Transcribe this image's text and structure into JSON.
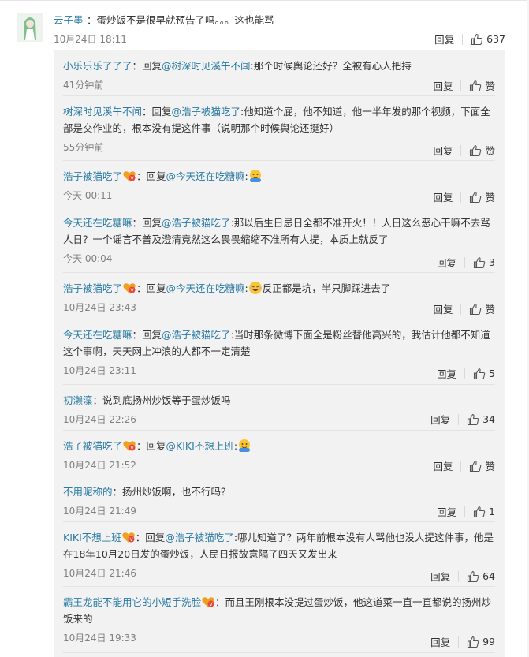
{
  "ui": {
    "reply_label": "回复",
    "zan_label": "赞",
    "reply_prefix": "：回复",
    "colon": "："
  },
  "main_comment": {
    "username": "云子墨-",
    "text": "：蛋炒饭不是很早就预告了吗。。。这也能骂",
    "time": "10月24日 18:11",
    "likes": "637"
  },
  "replies": [
    {
      "user": "小乐乐乐了了了",
      "to": "@树深时见溪午不闻",
      "body": ":那个时候舆论还好？全被有心人把持",
      "time": "41分钟前",
      "likes": "赞"
    },
    {
      "user": "树深时见溪午不闻",
      "to": "@浩子被猫吃了",
      "body": ":他知道个屁，他不知道，他一半年发的那个视频，下面全部是交作业的，根本没有提这件事（说明那个时候舆论还挺好）",
      "time": "55分钟前",
      "likes": "赞"
    },
    {
      "user": "浩子被猫吃了",
      "to": "@今天还在吃糖嘛",
      "body": ":",
      "time": "今天 00:11",
      "likes": "赞",
      "badge": true,
      "emoji": "hug"
    },
    {
      "user": "今天还在吃糖嘛",
      "to": "@浩子被猫吃了",
      "body": ":那以后生日忌日全都不准开火！！人日这么恶心干嘛不去骂人日？一个谣言不普及澄清竟然这么畏畏缩缩不准所有人提，本质上就反了",
      "time": "今天 00:04",
      "likes": "3"
    },
    {
      "user": "浩子被猫吃了",
      "to": "@今天还在吃糖嘛",
      "body": ":",
      "body2": "反正都是坑，半只脚踩进去了",
      "time": "10月24日 23:43",
      "likes": "赞",
      "badge": true,
      "emoji": "laugh"
    },
    {
      "user": "今天还在吃糖嘛",
      "to": "@浩子被猫吃了",
      "body": ":当时那条微博下面全是粉丝替他高兴的，我估计他都不知道这个事啊，天天网上冲浪的人都不一定清楚",
      "time": "10月24日 23:11",
      "likes": "5"
    },
    {
      "user": "初濑澟",
      "plain": "：说到底扬州炒饭等于蛋炒饭吗",
      "time": "10月24日 22:26",
      "likes": "34"
    },
    {
      "user": "浩子被猫吃了",
      "to": "@KIKI不想上班",
      "body": ":",
      "time": "10月24日 21:52",
      "likes": "赞",
      "badge": true,
      "emoji": "hug"
    },
    {
      "user": "不用昵称的",
      "plain": "：扬州炒饭啊，也不行吗？",
      "time": "10月24日 21:49",
      "likes": "1"
    },
    {
      "user": "KIKI不想上班",
      "to": "@浩子被猫吃了",
      "body": ":哪儿知道了？两年前根本没有人骂他也没人提这件事，他是在18年10月20日发的蛋炒饭，人民日报故意隔了四天又发出来",
      "time": "10月24日 21:46",
      "likes": "64",
      "badge": true
    },
    {
      "user": "霸王龙能不能用它的小短手洗脸",
      "plain": "：而且王刚根本没提过蛋炒饭，他这道菜一直一直都说的扬州炒饭来的",
      "time": "10月24日 19:33",
      "likes": "99",
      "badge": true
    }
  ],
  "colors": {
    "username": "#2a7aa3",
    "text": "#333333",
    "meta": "#808080",
    "reply_bg": "#f2f2f2"
  }
}
